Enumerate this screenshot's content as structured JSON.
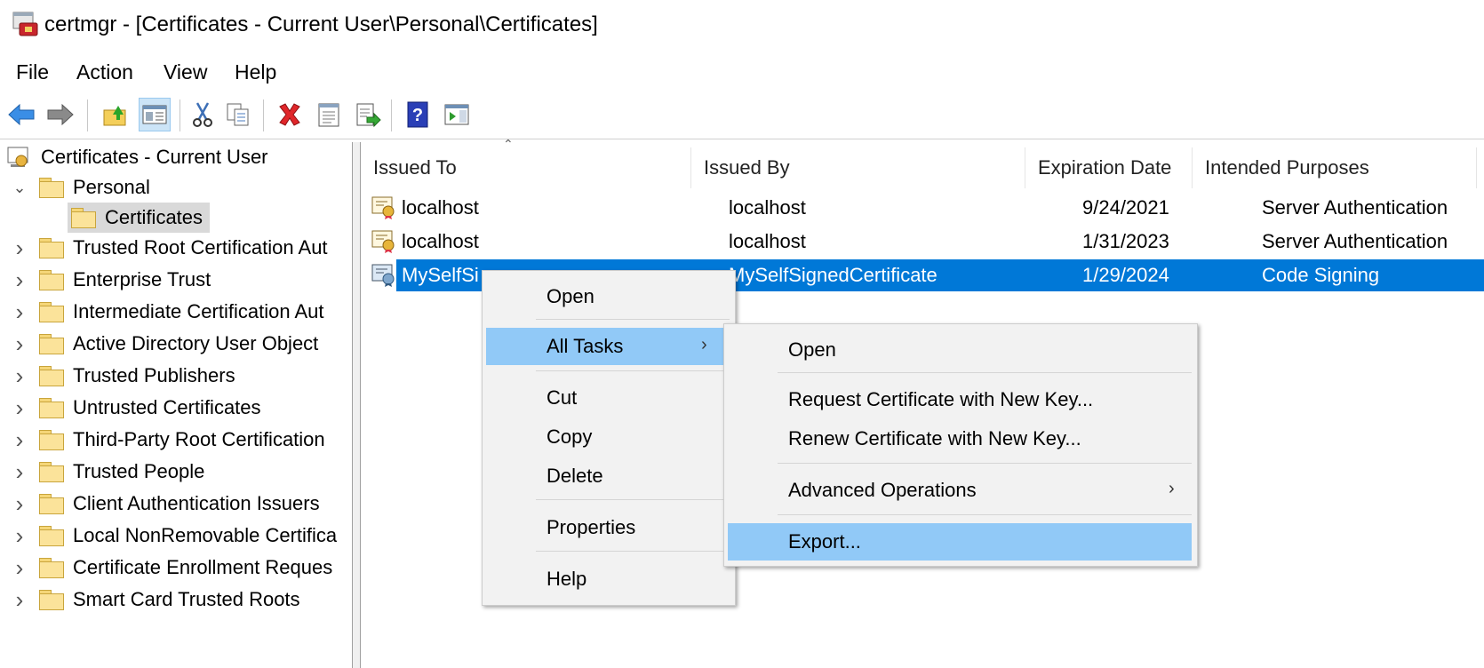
{
  "window": {
    "title": "certmgr - [Certificates - Current User\\Personal\\Certificates]"
  },
  "menubar": {
    "file": "File",
    "action": "Action",
    "view": "View",
    "help": "Help"
  },
  "toolbar": {
    "icons": [
      "back-arrow-icon",
      "forward-arrow-icon",
      "up-folder-icon",
      "show-hide-console-tree-icon",
      "cut-icon",
      "copy-icon",
      "delete-icon",
      "properties-icon",
      "export-list-icon",
      "help-icon",
      "show-action-pane-icon"
    ]
  },
  "tree": {
    "root": "Certificates - Current User",
    "personal": "Personal",
    "certificates": "Certificates",
    "items": [
      "Trusted Root Certification Aut",
      "Enterprise Trust",
      "Intermediate Certification Aut",
      "Active Directory User Object",
      "Trusted Publishers",
      "Untrusted Certificates",
      "Third-Party Root Certification",
      "Trusted People",
      "Client Authentication Issuers",
      "Local NonRemovable Certifica",
      "Certificate Enrollment Reques",
      "Smart Card Trusted Roots"
    ]
  },
  "list": {
    "columns": [
      "Issued To",
      "Issued By",
      "Expiration Date",
      "Intended Purposes"
    ],
    "rows": [
      {
        "issued_to": "localhost",
        "issued_by": "localhost",
        "expiration": "9/24/2021",
        "purposes": "Server Authentication"
      },
      {
        "issued_to": "localhost",
        "issued_by": "localhost",
        "expiration": "1/31/2023",
        "purposes": "Server Authentication"
      },
      {
        "issued_to": "MySelfSi",
        "issued_by": "MySelfSignedCertificate",
        "expiration": "1/29/2024",
        "purposes": "Code Signing"
      }
    ]
  },
  "context_menu": {
    "open": "Open",
    "all_tasks": "All Tasks",
    "cut": "Cut",
    "copy": "Copy",
    "delete": "Delete",
    "properties": "Properties",
    "help": "Help"
  },
  "submenu": {
    "open": "Open",
    "request_new_key": "Request Certificate with New Key...",
    "renew_new_key": "Renew Certificate with New Key...",
    "advanced": "Advanced Operations",
    "export": "Export..."
  },
  "colors": {
    "selection": "#0078d7",
    "menu_highlight": "#91c9f7",
    "tree_selected": "#d9d9d9"
  }
}
